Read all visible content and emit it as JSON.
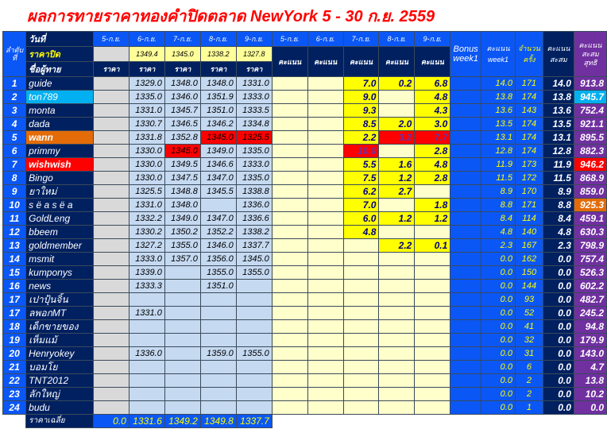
{
  "title": "ผลการทายราคาทองคำปิดตลาด NewYork 5 - 30 ก.ย. 2559",
  "header": {
    "rank_label": "ลำดับที่",
    "date_label": "วันที่",
    "close_label": "ราคาปิด",
    "name_label": "ชื่อผู้ทาย",
    "price_word": "ราคา",
    "score_word": "คะแนน",
    "dates": [
      "5-ก.ย.",
      "6-ก.ย.",
      "7-ก.ย.",
      "8-ก.ย.",
      "9-ก.ย."
    ],
    "close_prices": [
      "",
      "1349.4",
      "1345.0",
      "1338.2",
      "1327.8"
    ],
    "bonus_label": "Bonus week1",
    "week1_label_top": "คะแนน",
    "week1_label_bottom": "week1",
    "count_label_top": "จำนวน",
    "count_label_bottom": "ครั้ง",
    "sum_label_top": "คะแนน",
    "sum_label_bottom": "สะสม",
    "total_label": "คะแนน สะสม สุทธิ"
  },
  "rows": [
    {
      "rank": "1",
      "name": "guide",
      "prices": [
        "",
        "1329.0",
        "1348.0",
        "1348.0",
        "1331.0"
      ],
      "scores": [
        "",
        "",
        "7.0",
        "0.2",
        "6.8"
      ],
      "bonus": "",
      "week1": "14.0",
      "count": "171",
      "sum": "14.0",
      "total": "913.8"
    },
    {
      "rank": "2",
      "name": "ton789",
      "prices": [
        "",
        "1335.0",
        "1346.0",
        "1351.9",
        "1333.0"
      ],
      "scores": [
        "",
        "",
        "9.0",
        "",
        "4.8"
      ],
      "bonus": "",
      "week1": "13.8",
      "count": "174",
      "sum": "13.8",
      "total": "945.7"
    },
    {
      "rank": "3",
      "name": "monta",
      "prices": [
        "",
        "1331.0",
        "1345.7",
        "1351.0",
        "1333.5"
      ],
      "scores": [
        "",
        "",
        "9.3",
        "",
        "4.3"
      ],
      "bonus": "",
      "week1": "13.6",
      "count": "143",
      "sum": "13.6",
      "total": "752.4"
    },
    {
      "rank": "4",
      "name": "dada",
      "prices": [
        "",
        "1330.7",
        "1346.5",
        "1346.2",
        "1334.8"
      ],
      "scores": [
        "",
        "",
        "8.5",
        "2.0",
        "3.0"
      ],
      "bonus": "",
      "week1": "13.5",
      "count": "174",
      "sum": "13.5",
      "total": "921.1"
    },
    {
      "rank": "5",
      "name": "wann",
      "prices": [
        "",
        "1331.8",
        "1352.8",
        "1345.0",
        "1325.5"
      ],
      "scores": [
        "",
        "",
        "2.2",
        "3.2",
        "7.7"
      ],
      "bonus": "",
      "week1": "13.1",
      "count": "174",
      "sum": "13.1",
      "total": "895.5"
    },
    {
      "rank": "6",
      "name": "primmy",
      "prices": [
        "",
        "1330.0",
        "1345.0",
        "1349.0",
        "1335.0"
      ],
      "scores": [
        "",
        "",
        "10.0",
        "",
        "2.8"
      ],
      "bonus": "",
      "week1": "12.8",
      "count": "174",
      "sum": "12.8",
      "total": "882.3"
    },
    {
      "rank": "7",
      "name": "wishwish",
      "prices": [
        "",
        "1330.0",
        "1349.5",
        "1346.6",
        "1333.0"
      ],
      "scores": [
        "",
        "",
        "5.5",
        "1.6",
        "4.8"
      ],
      "bonus": "",
      "week1": "11.9",
      "count": "173",
      "sum": "11.9",
      "total": "946.2"
    },
    {
      "rank": "8",
      "name": "Bingo",
      "prices": [
        "",
        "1330.0",
        "1347.5",
        "1347.0",
        "1335.0"
      ],
      "scores": [
        "",
        "",
        "7.5",
        "1.2",
        "2.8"
      ],
      "bonus": "",
      "week1": "11.5",
      "count": "172",
      "sum": "11.5",
      "total": "868.9"
    },
    {
      "rank": "9",
      "name": "ยาใหม่",
      "prices": [
        "",
        "1325.5",
        "1348.8",
        "1345.5",
        "1338.8"
      ],
      "scores": [
        "",
        "",
        "6.2",
        "2.7",
        ""
      ],
      "bonus": "",
      "week1": "8.9",
      "count": "170",
      "sum": "8.9",
      "total": "859.0"
    },
    {
      "rank": "10",
      "name": "s ë a s ë a",
      "prices": [
        "",
        "1331.0",
        "1348.0",
        "",
        "1336.0"
      ],
      "scores": [
        "",
        "",
        "7.0",
        "",
        "1.8"
      ],
      "bonus": "",
      "week1": "8.8",
      "count": "171",
      "sum": "8.8",
      "total": "925.3"
    },
    {
      "rank": "11",
      "name": "GoldLeng",
      "prices": [
        "",
        "1332.2",
        "1349.0",
        "1347.0",
        "1336.6"
      ],
      "scores": [
        "",
        "",
        "6.0",
        "1.2",
        "1.2"
      ],
      "bonus": "",
      "week1": "8.4",
      "count": "114",
      "sum": "8.4",
      "total": "459.1"
    },
    {
      "rank": "12",
      "name": "bbeem",
      "prices": [
        "",
        "1330.2",
        "1350.2",
        "1352.2",
        "1338.2"
      ],
      "scores": [
        "",
        "",
        "4.8",
        "",
        ""
      ],
      "bonus": "",
      "week1": "4.8",
      "count": "140",
      "sum": "4.8",
      "total": "630.3"
    },
    {
      "rank": "13",
      "name": "goldmember",
      "prices": [
        "",
        "1327.2",
        "1355.0",
        "1346.0",
        "1337.7"
      ],
      "scores": [
        "",
        "",
        "",
        "2.2",
        "0.1"
      ],
      "bonus": "",
      "week1": "2.3",
      "count": "167",
      "sum": "2.3",
      "total": "798.9"
    },
    {
      "rank": "14",
      "name": "msmit",
      "prices": [
        "",
        "1333.0",
        "1357.0",
        "1356.0",
        "1345.0"
      ],
      "scores": [
        "",
        "",
        "",
        "",
        ""
      ],
      "bonus": "",
      "week1": "0.0",
      "count": "162",
      "sum": "0.0",
      "total": "757.4"
    },
    {
      "rank": "15",
      "name": "kumponys",
      "prices": [
        "",
        "1339.0",
        "",
        "1355.0",
        "1355.0"
      ],
      "scores": [
        "",
        "",
        "",
        "",
        ""
      ],
      "bonus": "",
      "week1": "0.0",
      "count": "150",
      "sum": "0.0",
      "total": "526.3"
    },
    {
      "rank": "16",
      "name": "news",
      "prices": [
        "",
        "1333.3",
        "",
        "1351.0",
        ""
      ],
      "scores": [
        "",
        "",
        "",
        "",
        ""
      ],
      "bonus": "",
      "week1": "0.0",
      "count": "144",
      "sum": "0.0",
      "total": "602.2"
    },
    {
      "rank": "17",
      "name": "เปาปุ้นจิ้น",
      "prices": [
        "",
        "",
        "",
        "",
        ""
      ],
      "scores": [
        "",
        "",
        "",
        "",
        ""
      ],
      "bonus": "",
      "week1": "0.0",
      "count": "93",
      "sum": "0.0",
      "total": "482.7"
    },
    {
      "rank": "17",
      "name": "ลพอกMT",
      "prices": [
        "",
        "1331.0",
        "",
        "",
        ""
      ],
      "scores": [
        "",
        "",
        "",
        "",
        ""
      ],
      "bonus": "",
      "week1": "0.0",
      "count": "52",
      "sum": "0.0",
      "total": "245.2"
    },
    {
      "rank": "18",
      "name": "เด็กขายของ",
      "prices": [
        "",
        "",
        "",
        "",
        ""
      ],
      "scores": [
        "",
        "",
        "",
        "",
        ""
      ],
      "bonus": "",
      "week1": "0.0",
      "count": "41",
      "sum": "0.0",
      "total": "94.8"
    },
    {
      "rank": "19",
      "name": "เห็มแม้",
      "prices": [
        "",
        "",
        "",
        "",
        ""
      ],
      "scores": [
        "",
        "",
        "",
        "",
        ""
      ],
      "bonus": "",
      "week1": "0.0",
      "count": "32",
      "sum": "0.0",
      "total": "179.9"
    },
    {
      "rank": "20",
      "name": "Henryokey",
      "prices": [
        "",
        "1336.0",
        "",
        "1359.0",
        "1355.0"
      ],
      "scores": [
        "",
        "",
        "",
        "",
        ""
      ],
      "bonus": "",
      "week1": "0.0",
      "count": "31",
      "sum": "0.0",
      "total": "143.0"
    },
    {
      "rank": "21",
      "name": "บอมโย",
      "prices": [
        "",
        "",
        "",
        "",
        ""
      ],
      "scores": [
        "",
        "",
        "",
        "",
        ""
      ],
      "bonus": "",
      "week1": "0.0",
      "count": "6",
      "sum": "0.0",
      "total": "4.7"
    },
    {
      "rank": "22",
      "name": "TNT2012",
      "prices": [
        "",
        "",
        "",
        "",
        ""
      ],
      "scores": [
        "",
        "",
        "",
        "",
        ""
      ],
      "bonus": "",
      "week1": "0.0",
      "count": "2",
      "sum": "0.0",
      "total": "13.8"
    },
    {
      "rank": "23",
      "name": "ลักใหญ่",
      "prices": [
        "",
        "",
        "",
        "",
        ""
      ],
      "scores": [
        "",
        "",
        "",
        "",
        ""
      ],
      "bonus": "",
      "week1": "0.0",
      "count": "2",
      "sum": "0.0",
      "total": "10.2"
    },
    {
      "rank": "24",
      "name": "budu",
      "prices": [
        "",
        "",
        "",
        "",
        ""
      ],
      "scores": [
        "",
        "",
        "",
        "",
        ""
      ],
      "bonus": "",
      "week1": "0.0",
      "count": "1",
      "sum": "0.0",
      "total": "0.0"
    }
  ],
  "average": {
    "label": "ราคาเฉลี่ย",
    "values": [
      "0.0",
      "1331.6",
      "1349.2",
      "1349.8",
      "1337.7"
    ]
  },
  "colors": {
    "blue": "#0b57f5",
    "navy": "#002060",
    "purple": "#7030a0",
    "yellow": "#ffff00",
    "cream": "#ffffcc",
    "lightblue": "#c5d9f1",
    "red": "#ff0000",
    "orange": "#e36c09",
    "cyan": "#00b0f0"
  }
}
